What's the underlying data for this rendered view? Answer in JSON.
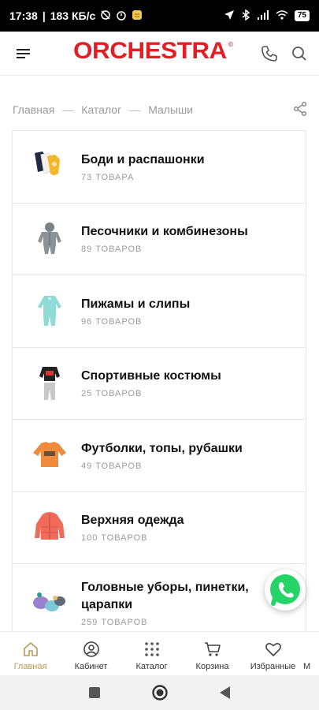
{
  "status_bar": {
    "time": "17:38",
    "net_speed": "183 КБ/с",
    "battery": "75"
  },
  "header": {
    "brand": "ORCHESTRA",
    "brand_mark": "©"
  },
  "breadcrumb": {
    "items": [
      "Главная",
      "Каталог",
      "Малыши"
    ],
    "separator": "—"
  },
  "categories": [
    {
      "name": "Боди и распашонки",
      "count": "73 ТОВАРА"
    },
    {
      "name": "Песочники и комбинезоны",
      "count": "89 ТОВАРОВ"
    },
    {
      "name": "Пижамы и слипы",
      "count": "96 ТОВАРОВ"
    },
    {
      "name": "Спортивные костюмы",
      "count": "25 ТОВАРОВ"
    },
    {
      "name": "Футболки, топы, рубашки",
      "count": "49 ТОВАРОВ"
    },
    {
      "name": "Верхняя одежда",
      "count": "100 ТОВАРОВ"
    },
    {
      "name": "Головные уборы, пинетки, царапки",
      "count": "259 ТОВАРОВ"
    }
  ],
  "bottom_nav": {
    "items": [
      "Главная",
      "Кабинет",
      "Каталог",
      "Корзина",
      "Избранные",
      "М"
    ],
    "active_index": 0
  },
  "colors": {
    "brand": "#e31e24",
    "active_nav": "#b89a5c",
    "whatsapp": "#25d366"
  },
  "icons": {
    "menu": "hamburger-icon",
    "phone": "phone-icon",
    "search": "search-icon",
    "share": "share-icon",
    "whatsapp": "whatsapp-icon"
  }
}
